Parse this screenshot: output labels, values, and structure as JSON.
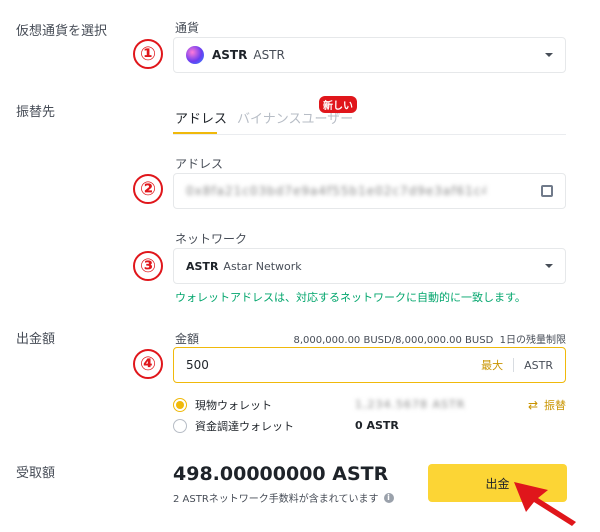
{
  "sections": {
    "select_coin": "仮想通貨を選択",
    "destination": "振替先",
    "amount": "出金額",
    "receive": "受取額"
  },
  "markers": {
    "m1": "①",
    "m2": "②",
    "m3": "③",
    "m4": "④"
  },
  "coin": {
    "label": "通貨",
    "symbol": "ASTR",
    "name": "ASTR"
  },
  "tabs": {
    "address": "アドレス",
    "binance_user": "バイナンスユーザー",
    "new_badge": "新しい"
  },
  "address": {
    "label": "アドレス",
    "value": "0x8fa21c03bd7e9a4f55b1e02c7d9e3af61c448b2e0fd7"
  },
  "network": {
    "label": "ネットワーク",
    "symbol": "ASTR",
    "name": "Astar Network",
    "hint": "ウォレットアドレスは、対応するネットワークに自動的に一致します。"
  },
  "amount": {
    "label": "金額",
    "limit": "8,000,000.00 BUSD/8,000,000.00 BUSD  1日の残量制限",
    "value": "500",
    "max": "最大",
    "unit": "ASTR"
  },
  "wallets": {
    "spot": "現物ウォレット",
    "spot_balance": "1,234.5678 ASTR",
    "funding": "資金調達ウォレット",
    "funding_balance": "0 ASTR",
    "transfer": "振替"
  },
  "receive": {
    "amount": "498.00000000 ASTR",
    "fee_note": "2 ASTRネットワーク手数料が含まれています"
  },
  "submit": "出金",
  "colors": {
    "accent": "#f0b90b",
    "marker": "#e0161b",
    "hint_green": "#03a66d",
    "badge": "#e0161b"
  }
}
